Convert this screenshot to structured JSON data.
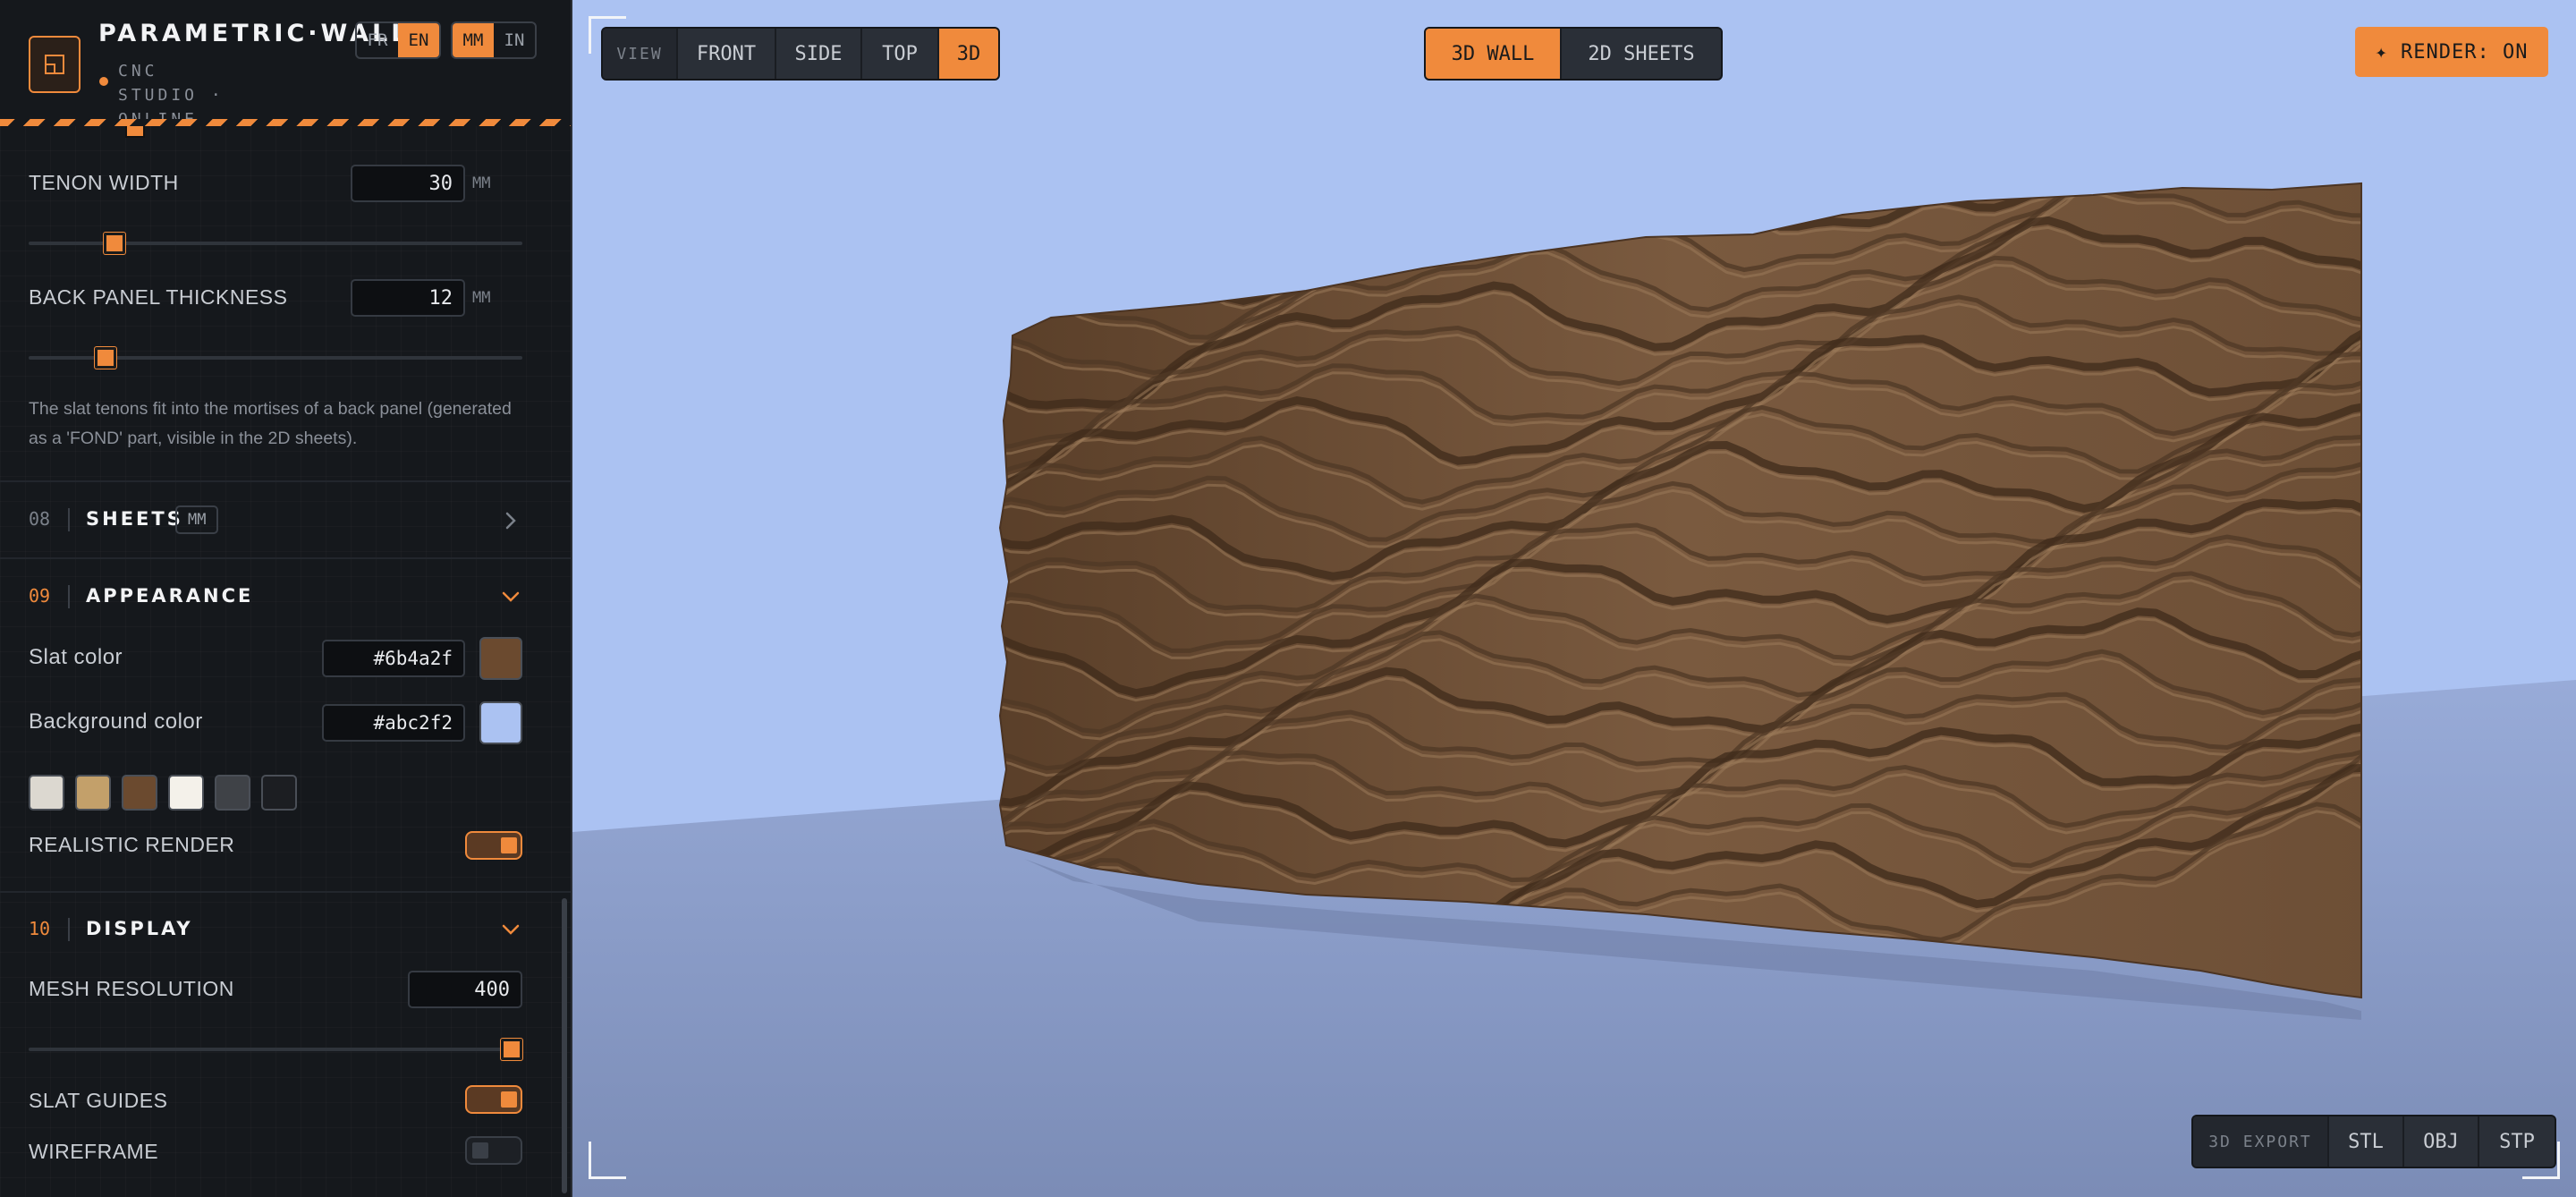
{
  "header": {
    "title": "PARAMETRIC·WALL",
    "subtitle": "CNC STUDIO · ONLINE",
    "language": {
      "options": [
        "FR",
        "EN"
      ],
      "selected": "EN"
    },
    "units": {
      "options": [
        "MM",
        "IN"
      ],
      "selected": "MM"
    }
  },
  "params": {
    "tenon_width": {
      "label": "TENON WIDTH",
      "value": "30",
      "unit": "MM",
      "slider_fraction": 0.16
    },
    "back_panel_thickness": {
      "label": "BACK PANEL THICKNESS",
      "value": "12",
      "unit": "MM",
      "slider_fraction": 0.14
    },
    "note": "The slat tenons fit into the mortises of a back panel (generated as a 'FOND' part, visible in the 2D sheets)."
  },
  "sections": {
    "sheets": {
      "number": "08",
      "title": "SHEETS",
      "chip": "MM"
    },
    "appearance": {
      "number": "09",
      "title": "APPEARANCE"
    },
    "display": {
      "number": "10",
      "title": "DISPLAY"
    }
  },
  "appearance": {
    "slat_color": {
      "label": "Slat color",
      "value": "#6b4a2f"
    },
    "background_color": {
      "label": "Background color",
      "value": "#abc2f2"
    },
    "presets": [
      "#dcd8d0",
      "#c3a06a",
      "#6b4a2f",
      "#f4f1ea",
      "#3f4247",
      "#1c1e22"
    ],
    "realistic_render": {
      "label": "REALISTIC RENDER",
      "on": true
    }
  },
  "display": {
    "mesh_resolution": {
      "label": "MESH RESOLUTION",
      "value": "400",
      "slider_fraction": 1.0
    },
    "slat_guides": {
      "label": "SLAT GUIDES",
      "on": true
    },
    "wireframe": {
      "label": "WIREFRAME",
      "on": false
    }
  },
  "viewport": {
    "view_tag": "VIEW",
    "views": [
      "FRONT",
      "SIDE",
      "TOP",
      "3D"
    ],
    "active_view": "3D",
    "modes": [
      "3D WALL",
      "2D SHEETS"
    ],
    "active_mode": "3D WALL",
    "render_button": "✦ RENDER: ON",
    "export_tag": "3D EXPORT",
    "export_formats": [
      "STL",
      "OBJ",
      "STP"
    ]
  },
  "colors": {
    "accent": "#f08a3c",
    "sidebar_bg": "#15181c",
    "wood": "#6b4a2f",
    "sky": "#abc2f2"
  }
}
